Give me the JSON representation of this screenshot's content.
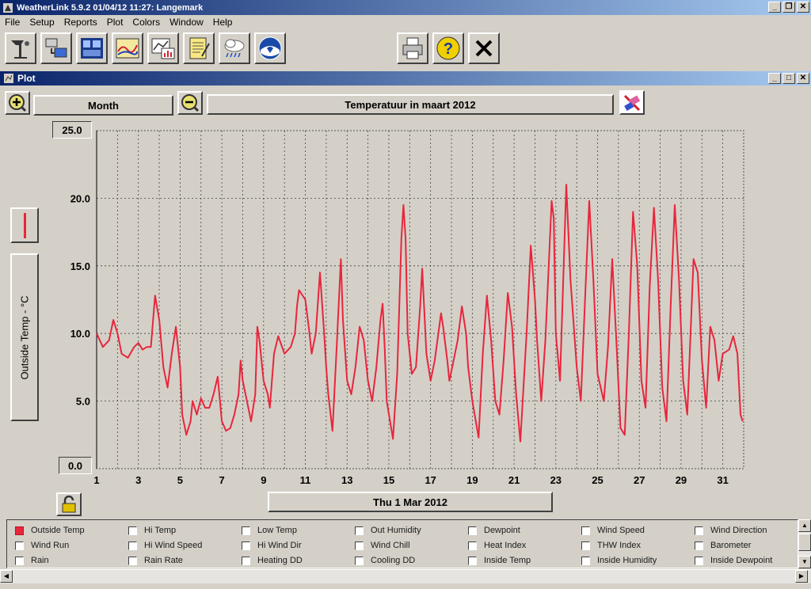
{
  "app": {
    "title": "WeatherLink 5.9.2  01/04/12  11:27: Langemark"
  },
  "menu": [
    "File",
    "Setup",
    "Reports",
    "Plot",
    "Colors",
    "Window",
    "Help"
  ],
  "toolbar": {
    "icons": [
      "station-icon",
      "download-icon",
      "bulletin-icon",
      "strip-chart-icon",
      "plot-icon",
      "notepad-icon",
      "weather-cloud-icon",
      "noaa-icon",
      "print-icon",
      "help-icon",
      "close-icon"
    ]
  },
  "plot_window": {
    "title": "Plot",
    "span_label": "Month",
    "plot_title": "Temperatuur in maart 2012",
    "date_label": "Thu 1 Mar 2012",
    "y_axis_title": "Outside Temp - °C",
    "y_max_label": "25.0",
    "y_min_label": "0.0",
    "line_color": "#e8263c",
    "lock_state": "unlocked"
  },
  "chart_data": {
    "type": "line",
    "title": "Temperatuur in maart 2012",
    "ylabel": "Outside Temp - °C",
    "ylim": [
      0,
      25
    ],
    "xlim": [
      1,
      32
    ],
    "grid": true,
    "x_ticks": [
      "1",
      "3",
      "5",
      "7",
      "9",
      "11",
      "13",
      "15",
      "17",
      "19",
      "21",
      "23",
      "25",
      "27",
      "29",
      "31"
    ],
    "y_ticks": [
      "25.0",
      "20.0",
      "15.0",
      "10.0",
      "5.0",
      "0.0"
    ],
    "series": [
      {
        "name": "Outside Temp",
        "color": "#e8263c",
        "points": [
          [
            1.0,
            10.0
          ],
          [
            1.3,
            9.0
          ],
          [
            1.6,
            9.5
          ],
          [
            1.8,
            11.0
          ],
          [
            2.0,
            10.0
          ],
          [
            2.2,
            8.5
          ],
          [
            2.5,
            8.2
          ],
          [
            2.8,
            9.0
          ],
          [
            3.0,
            9.3
          ],
          [
            3.2,
            8.8
          ],
          [
            3.4,
            9.0
          ],
          [
            3.6,
            9.0
          ],
          [
            3.8,
            12.8
          ],
          [
            4.0,
            11.0
          ],
          [
            4.2,
            7.5
          ],
          [
            4.4,
            6.0
          ],
          [
            4.6,
            8.5
          ],
          [
            4.8,
            10.5
          ],
          [
            5.0,
            7.5
          ],
          [
            5.1,
            4.0
          ],
          [
            5.3,
            2.5
          ],
          [
            5.5,
            3.5
          ],
          [
            5.6,
            5.0
          ],
          [
            5.8,
            4.0
          ],
          [
            6.0,
            5.2
          ],
          [
            6.2,
            4.5
          ],
          [
            6.4,
            4.5
          ],
          [
            6.6,
            5.5
          ],
          [
            6.8,
            6.8
          ],
          [
            7.0,
            3.5
          ],
          [
            7.2,
            2.8
          ],
          [
            7.4,
            3.0
          ],
          [
            7.6,
            4.0
          ],
          [
            7.8,
            5.5
          ],
          [
            7.9,
            8.0
          ],
          [
            8.0,
            6.5
          ],
          [
            8.2,
            5.0
          ],
          [
            8.4,
            3.5
          ],
          [
            8.6,
            5.5
          ],
          [
            8.7,
            10.5
          ],
          [
            8.8,
            9.5
          ],
          [
            9.0,
            6.5
          ],
          [
            9.2,
            5.5
          ],
          [
            9.3,
            4.5
          ],
          [
            9.5,
            8.5
          ],
          [
            9.7,
            9.8
          ],
          [
            10.0,
            8.5
          ],
          [
            10.3,
            9.0
          ],
          [
            10.5,
            10.0
          ],
          [
            10.6,
            12.0
          ],
          [
            10.7,
            13.2
          ],
          [
            11.0,
            12.5
          ],
          [
            11.2,
            10.0
          ],
          [
            11.3,
            8.5
          ],
          [
            11.5,
            10.0
          ],
          [
            11.7,
            14.5
          ],
          [
            11.9,
            10.0
          ],
          [
            12.0,
            7.5
          ],
          [
            12.1,
            5.5
          ],
          [
            12.3,
            2.8
          ],
          [
            12.5,
            9.0
          ],
          [
            12.7,
            15.5
          ],
          [
            12.8,
            11.0
          ],
          [
            13.0,
            6.5
          ],
          [
            13.2,
            5.5
          ],
          [
            13.4,
            7.5
          ],
          [
            13.6,
            10.5
          ],
          [
            13.8,
            9.5
          ],
          [
            14.0,
            6.5
          ],
          [
            14.2,
            5.0
          ],
          [
            14.4,
            7.5
          ],
          [
            14.6,
            11.0
          ],
          [
            14.7,
            12.2
          ],
          [
            14.8,
            9.0
          ],
          [
            14.9,
            5.0
          ],
          [
            15.2,
            2.2
          ],
          [
            15.4,
            7.0
          ],
          [
            15.6,
            17.0
          ],
          [
            15.7,
            19.5
          ],
          [
            15.8,
            17.0
          ],
          [
            15.9,
            10.0
          ],
          [
            16.1,
            7.0
          ],
          [
            16.3,
            7.5
          ],
          [
            16.5,
            12.0
          ],
          [
            16.6,
            14.8
          ],
          [
            16.8,
            8.5
          ],
          [
            17.0,
            6.5
          ],
          [
            17.2,
            8.0
          ],
          [
            17.5,
            11.5
          ],
          [
            17.6,
            10.5
          ],
          [
            17.8,
            8.0
          ],
          [
            17.9,
            6.5
          ],
          [
            18.1,
            8.0
          ],
          [
            18.3,
            9.5
          ],
          [
            18.5,
            12.0
          ],
          [
            18.7,
            10.0
          ],
          [
            18.8,
            7.5
          ],
          [
            19.0,
            5.0
          ],
          [
            19.3,
            2.3
          ],
          [
            19.5,
            8.5
          ],
          [
            19.7,
            12.8
          ],
          [
            19.9,
            9.5
          ],
          [
            20.1,
            5.0
          ],
          [
            20.3,
            4.0
          ],
          [
            20.5,
            8.0
          ],
          [
            20.7,
            13.0
          ],
          [
            20.9,
            10.5
          ],
          [
            21.1,
            5.5
          ],
          [
            21.3,
            2.0
          ],
          [
            21.6,
            10.0
          ],
          [
            21.8,
            16.5
          ],
          [
            22.0,
            12.5
          ],
          [
            22.1,
            9.5
          ],
          [
            22.3,
            5.0
          ],
          [
            22.5,
            9.5
          ],
          [
            22.8,
            19.8
          ],
          [
            22.9,
            18.5
          ],
          [
            23.0,
            10.0
          ],
          [
            23.2,
            6.5
          ],
          [
            23.5,
            21.0
          ],
          [
            23.7,
            14.0
          ],
          [
            24.0,
            7.5
          ],
          [
            24.2,
            5.0
          ],
          [
            24.4,
            12.5
          ],
          [
            24.6,
            19.8
          ],
          [
            24.8,
            14.0
          ],
          [
            25.0,
            7.0
          ],
          [
            25.3,
            5.0
          ],
          [
            25.5,
            9.0
          ],
          [
            25.7,
            15.5
          ],
          [
            25.9,
            9.5
          ],
          [
            26.1,
            3.0
          ],
          [
            26.3,
            2.5
          ],
          [
            26.5,
            10.0
          ],
          [
            26.7,
            19.0
          ],
          [
            26.9,
            15.0
          ],
          [
            27.1,
            6.5
          ],
          [
            27.3,
            4.5
          ],
          [
            27.5,
            13.5
          ],
          [
            27.7,
            19.3
          ],
          [
            27.9,
            14.0
          ],
          [
            28.1,
            6.0
          ],
          [
            28.3,
            3.5
          ],
          [
            28.5,
            12.0
          ],
          [
            28.7,
            19.5
          ],
          [
            28.9,
            14.0
          ],
          [
            29.1,
            6.5
          ],
          [
            29.3,
            4.0
          ],
          [
            29.6,
            15.5
          ],
          [
            29.8,
            14.5
          ],
          [
            30.0,
            8.0
          ],
          [
            30.2,
            4.5
          ],
          [
            30.4,
            10.5
          ],
          [
            30.6,
            9.5
          ],
          [
            30.8,
            6.5
          ],
          [
            31.0,
            8.5
          ],
          [
            31.3,
            8.8
          ],
          [
            31.5,
            9.8
          ],
          [
            31.7,
            8.5
          ],
          [
            31.85,
            4.0
          ],
          [
            31.95,
            3.5
          ]
        ]
      }
    ]
  },
  "legend": {
    "items": [
      {
        "label": "Outside Temp",
        "checked": true
      },
      {
        "label": "Hi Temp",
        "checked": false
      },
      {
        "label": "Low Temp",
        "checked": false
      },
      {
        "label": "Out Humidity",
        "checked": false
      },
      {
        "label": "Dewpoint",
        "checked": false
      },
      {
        "label": "Wind Speed",
        "checked": false
      },
      {
        "label": "Wind Direction",
        "checked": false
      },
      {
        "label": "Wind Run",
        "checked": false
      },
      {
        "label": "Hi Wind Speed",
        "checked": false
      },
      {
        "label": "Hi Wind Dir",
        "checked": false
      },
      {
        "label": "Wind Chill",
        "checked": false
      },
      {
        "label": "Heat Index",
        "checked": false
      },
      {
        "label": "THW Index",
        "checked": false
      },
      {
        "label": "Barometer",
        "checked": false
      },
      {
        "label": "Rain",
        "checked": false
      },
      {
        "label": "Rain Rate",
        "checked": false
      },
      {
        "label": "Heating DD",
        "checked": false
      },
      {
        "label": "Cooling DD",
        "checked": false
      },
      {
        "label": "Inside Temp",
        "checked": false
      },
      {
        "label": "Inside Humidity",
        "checked": false
      },
      {
        "label": "Inside Dewpoint",
        "checked": false
      }
    ]
  }
}
